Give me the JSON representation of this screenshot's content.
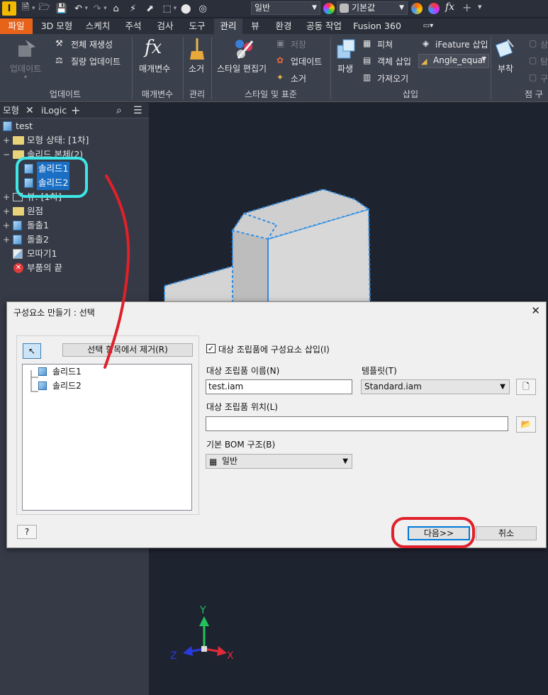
{
  "quick_access": {
    "style_dropdown": "일반",
    "color_dropdown": "기본값"
  },
  "tabs": [
    "파일",
    "3D 모형",
    "스케치",
    "주석",
    "검사",
    "도구",
    "관리",
    "뷰",
    "환경",
    "공동 작업",
    "Fusion 360"
  ],
  "ribbon": {
    "update_panel": {
      "title": "업데이트",
      "update": "업데이트",
      "rebuild_all": "전체 재생성",
      "mass_update": "질량 업데이트"
    },
    "params_panel": {
      "title": "매개변수",
      "params": "매개변수"
    },
    "manage_panel": {
      "title": "관리",
      "purge": "소거"
    },
    "styles_panel": {
      "title": "스타일 및 표준",
      "style_editor": "스타일 편집기",
      "save": "저장",
      "update": "업데이트",
      "purge": "소거"
    },
    "insert_panel": {
      "title": "삽입",
      "derive": "파생",
      "feature": "피쳐",
      "insert_object": "객체 삽입",
      "import": "가져오기",
      "ifeature": "iFeature 삽입",
      "angle_equal": "Angle_equal"
    },
    "attach_panel": {
      "title": "점 구",
      "attach": "부착",
      "c1": "상",
      "c2": "탐",
      "c3": "구"
    }
  },
  "browser": {
    "tab_model": "모형",
    "tab_ilogic": "iLogic",
    "items": [
      "test",
      "모형 상태: [1차]",
      "솔리드 본체(2)",
      "솔리드1",
      "솔리드2",
      "뷰: [1차]",
      "원점",
      "돌출1",
      "돌출2",
      "모따기1",
      "부품의 끝"
    ]
  },
  "dialog": {
    "title": "구성요소 만들기 : 선택",
    "remove_button": "선택 항목에서 제거(R)",
    "list": [
      "솔리드1",
      "솔리드2"
    ],
    "insert_checkbox": "대상 조립품에 구성요소 삽입(I)",
    "target_name_label": "대상 조립품 이름(N)",
    "target_name_value": "test.iam",
    "template_label": "템플릿(T)",
    "template_value": "Standard.iam",
    "target_location_label": "대상 조립품 위치(L)",
    "target_location_value": "",
    "bom_label": "기본 BOM 구조(B)",
    "bom_value": "일반",
    "next_button": "다음>>",
    "cancel_button": "취소"
  },
  "axes": {
    "x": "X",
    "y": "Y",
    "z": "Z"
  },
  "colors": {
    "accent_orange": "#e8631a",
    "selection_blue": "#1a6fc4",
    "highlight_cyan": "#3fe6e6",
    "annotation_red": "#e0202a"
  }
}
